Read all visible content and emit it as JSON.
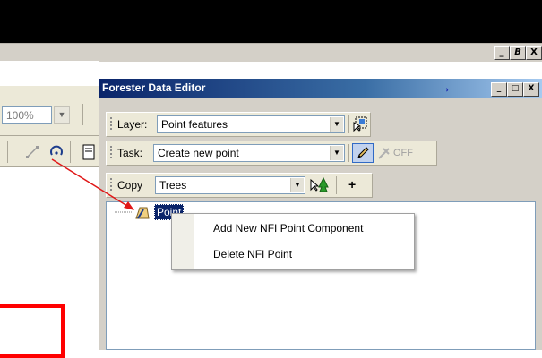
{
  "mdi_controls": [
    "_",
    "B",
    "X"
  ],
  "left_toolbar": {
    "zoom_value": "100%",
    "zoom_drop": "▼"
  },
  "panel": {
    "title": "Forester Data Editor",
    "pin_glyph": "→",
    "window_controls": [
      "_",
      "□",
      "X"
    ]
  },
  "layer_row": {
    "label": "Layer:",
    "value": "Point features",
    "drop": "▼"
  },
  "task_row": {
    "label": "Task:",
    "value": "Create new point",
    "drop": "▼",
    "off_label": "OFF"
  },
  "copy_row": {
    "label": "Copy",
    "value": "Trees",
    "drop": "▼",
    "plus": "+"
  },
  "tree": {
    "node_label": "Point"
  },
  "context_menu": {
    "items": [
      "Add New NFI Point Component",
      "Delete NFI Point"
    ]
  },
  "colors": {
    "title_gradient_start": "#0a246a",
    "selection": "#0a246a",
    "annotation_red": "#ff0000"
  }
}
